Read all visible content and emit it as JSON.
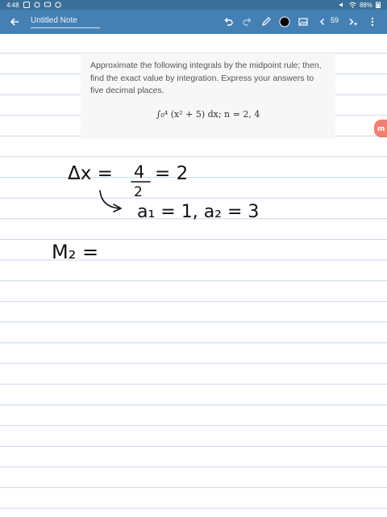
{
  "status_bar": {
    "time": "4:48",
    "battery": "88%"
  },
  "toolbar": {
    "note_title": "Untitled Note",
    "page_number": "59"
  },
  "problem": {
    "text": "Approximate the following integrals by the midpoint rule; then, find the exact value by integration. Express your answers to five decimal places.",
    "formula": "∫₀⁴ (x² + 5) dx; n = 2, 4"
  },
  "handwriting": {
    "line1_left": "Δx =",
    "line1_num": "4",
    "line1_den": "2",
    "line1_result": "= 2",
    "line2": "a₁ = 1,  a₂ = 3",
    "line3": "M₂ ="
  },
  "colors": {
    "toolbar": "#4580b4",
    "status_bar": "#3a6f99",
    "ruled_line": "#c9d7ea",
    "accent_badge": "#f06a5a"
  }
}
